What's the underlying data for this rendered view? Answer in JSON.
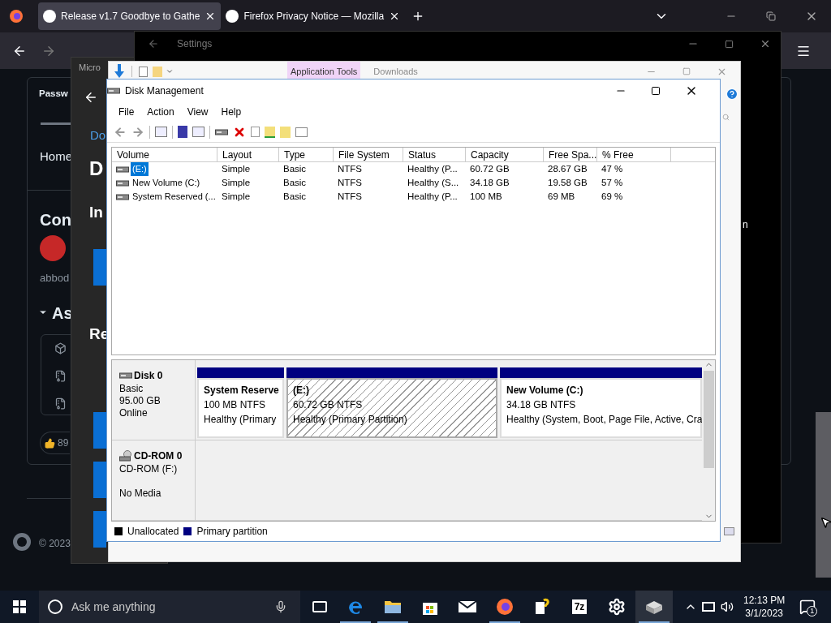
{
  "browser": {
    "tabs": [
      {
        "title": "Release v1.7 Goodbye to Gathe",
        "selected": true
      },
      {
        "title": "Firefox Privacy Notice — Mozilla",
        "selected": false
      }
    ]
  },
  "web_page": {
    "nav_item": "Passw",
    "home_link": "Home",
    "contributors_heading": "Con",
    "username": "abbod",
    "assets_heading": "As",
    "reaction_count": "89",
    "footer": "© 2023"
  },
  "store_window": {
    "title": "Micro",
    "link": "Do",
    "heading": "D",
    "section_1": "In",
    "section_2": "Re"
  },
  "settings_window": {
    "title": "Settings",
    "text_fragment": "n"
  },
  "explorer_window": {
    "ribbon_tabs": [
      {
        "label": "Application Tools",
        "selected": true
      },
      {
        "label": "Downloads",
        "selected": false
      }
    ]
  },
  "disk_management": {
    "title": "Disk Management",
    "menu": [
      "File",
      "Action",
      "View",
      "Help"
    ],
    "columns": [
      "Volume",
      "Layout",
      "Type",
      "File System",
      "Status",
      "Capacity",
      "Free Spa...",
      "% Free"
    ],
    "rows": [
      {
        "cells": [
          "(E:)",
          "Simple",
          "Basic",
          "NTFS",
          "Healthy (P...",
          "60.72 GB",
          "28.67 GB",
          "47 %"
        ],
        "selected": true
      },
      {
        "cells": [
          "New Volume (C:)",
          "Simple",
          "Basic",
          "NTFS",
          "Healthy (S...",
          "34.18 GB",
          "19.58 GB",
          "57 %"
        ],
        "selected": false
      },
      {
        "cells": [
          "System Reserved (...",
          "Simple",
          "Basic",
          "NTFS",
          "Healthy (P...",
          "100 MB",
          "69 MB",
          "69 %"
        ],
        "selected": false
      }
    ],
    "disks": [
      {
        "kind": "disk",
        "name": "Disk 0",
        "lines": [
          "Basic",
          "95.00 GB",
          "Online"
        ],
        "partitions": [
          {
            "name": "System Reserve",
            "size": "100 MB NTFS",
            "status": "Healthy (Primary",
            "selected": false
          },
          {
            "name": "(E:)",
            "size": "60.72 GB NTFS",
            "status": "Healthy (Primary Partition)",
            "selected": true
          },
          {
            "name": "New Volume  (C:)",
            "size": "34.18 GB NTFS",
            "status": "Healthy (System, Boot, Page File, Active, Cra",
            "selected": false
          }
        ]
      },
      {
        "kind": "cdrom",
        "name": "CD-ROM 0",
        "lines": [
          "CD-ROM (F:)",
          "No Media"
        ]
      }
    ],
    "legend": [
      {
        "label": "Unallocated",
        "color": "#000000"
      },
      {
        "label": "Primary partition",
        "color": "#000080"
      }
    ]
  },
  "taskbar": {
    "search_placeholder": "Ask me anything",
    "apps": [
      {
        "kind": "edge",
        "running": true
      },
      {
        "kind": "folder",
        "running": true
      },
      {
        "kind": "store",
        "running": false
      },
      {
        "kind": "mail",
        "running": false
      },
      {
        "kind": "firefox",
        "running": true
      },
      {
        "kind": "help",
        "running": false
      },
      {
        "kind": "archiver",
        "label": "7z",
        "running": false
      },
      {
        "kind": "gear",
        "running": false
      },
      {
        "kind": "disk",
        "running": true
      }
    ],
    "time": "12:13 PM",
    "date": "3/1/2023",
    "notification_count": "1"
  }
}
